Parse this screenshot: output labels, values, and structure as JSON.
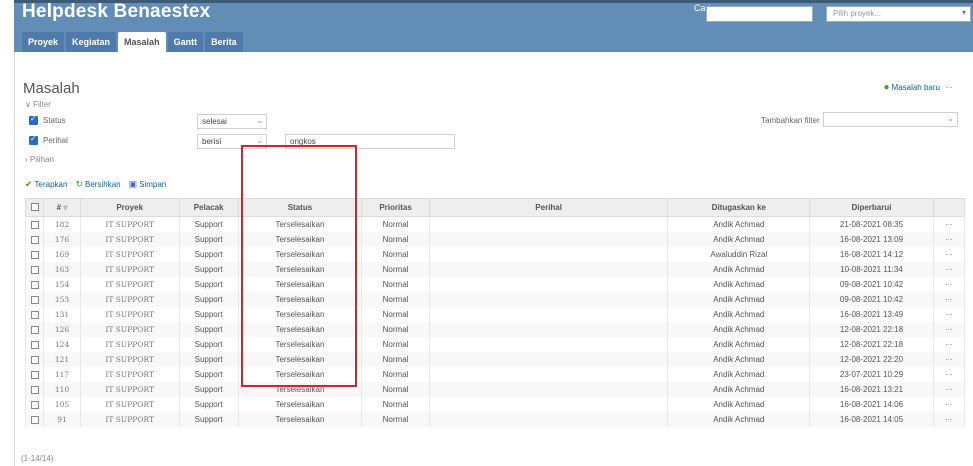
{
  "header": {
    "title": "Helpdesk Benaestex",
    "search_label": "Cari:",
    "project_placeholder": "Pilih proyek..."
  },
  "tabs": [
    "Proyek",
    "Kegiatan",
    "Masalah",
    "Gantt",
    "Berita"
  ],
  "active_tab": "Masalah",
  "page": {
    "title": "Masalah",
    "new_issue": "Masalah baru",
    "more": "···"
  },
  "filters": {
    "toggle": "Filter",
    "status": {
      "label": "Status",
      "operator": "selesai"
    },
    "subject": {
      "label": "Perihal",
      "operator": "berisi",
      "value": "ongkos"
    },
    "add_filter_label": "Tambahkan filter",
    "options_toggle": "Pilihan"
  },
  "actions": {
    "apply": "Terapkan",
    "clear": "Bersihkan",
    "save": "Simpan"
  },
  "table": {
    "headers": {
      "id": "#",
      "project": "Proyek",
      "tracker": "Pelacak",
      "status": "Status",
      "priority": "Prioritas",
      "subject": "Perihal",
      "assignee": "Ditugaskan ke",
      "updated": "Diperbarui"
    },
    "rows": [
      {
        "id": "182",
        "project": "IT SUPPORT",
        "tracker": "Support",
        "status": "Terselesaikan",
        "priority": "Normal",
        "assignee": "Andik Achmad",
        "updated": "21-08-2021 08:35"
      },
      {
        "id": "176",
        "project": "IT SUPPORT",
        "tracker": "Support",
        "status": "Terselesaikan",
        "priority": "Normal",
        "assignee": "Andik Achmad",
        "updated": "16-08-2021 13:09"
      },
      {
        "id": "169",
        "project": "IT SUPPORT",
        "tracker": "Support",
        "status": "Terselesaikan",
        "priority": "Normal",
        "assignee": "Awaluddin Rizal",
        "updated": "16-08-2021 14:12"
      },
      {
        "id": "163",
        "project": "IT SUPPORT",
        "tracker": "Support",
        "status": "Terselesaikan",
        "priority": "Normal",
        "assignee": "Andik Achmad",
        "updated": "10-08-2021 11:34"
      },
      {
        "id": "154",
        "project": "IT SUPPORT",
        "tracker": "Support",
        "status": "Terselesaikan",
        "priority": "Normal",
        "assignee": "Andik Achmad",
        "updated": "09-08-2021 10:42"
      },
      {
        "id": "153",
        "project": "IT SUPPORT",
        "tracker": "Support",
        "status": "Terselesaikan",
        "priority": "Normal",
        "assignee": "Andik Achmad",
        "updated": "09-08-2021 10:42"
      },
      {
        "id": "131",
        "project": "IT SUPPORT",
        "tracker": "Support",
        "status": "Terselesaikan",
        "priority": "Normal",
        "assignee": "Andik Achmad",
        "updated": "16-08-2021 13:49"
      },
      {
        "id": "126",
        "project": "IT SUPPORT",
        "tracker": "Support",
        "status": "Terselesaikan",
        "priority": "Normal",
        "assignee": "Andik Achmad",
        "updated": "12-08-2021 22:18"
      },
      {
        "id": "124",
        "project": "IT SUPPORT",
        "tracker": "Support",
        "status": "Terselesaikan",
        "priority": "Normal",
        "assignee": "Andik Achmad",
        "updated": "12-08-2021 22:18"
      },
      {
        "id": "121",
        "project": "IT SUPPORT",
        "tracker": "Support",
        "status": "Terselesaikan",
        "priority": "Normal",
        "assignee": "Andik Achmad",
        "updated": "12-08-2021 22:20"
      },
      {
        "id": "117",
        "project": "IT SUPPORT",
        "tracker": "Support",
        "status": "Terselesaikan",
        "priority": "Normal",
        "assignee": "Andik Achmad",
        "updated": "23-07-2021 10:29"
      },
      {
        "id": "110",
        "project": "IT SUPPORT",
        "tracker": "Support",
        "status": "Terselesaikan",
        "priority": "Normal",
        "assignee": "Andik Achmad",
        "updated": "16-08-2021 13:21"
      },
      {
        "id": "105",
        "project": "IT SUPPORT",
        "tracker": "Support",
        "status": "Terselesaikan",
        "priority": "Normal",
        "assignee": "Andik Achmad",
        "updated": "16-08-2021 14:06"
      },
      {
        "id": "91",
        "project": "IT SUPPORT",
        "tracker": "Support",
        "status": "Terselesaikan",
        "priority": "Normal",
        "assignee": "Andik Achmad",
        "updated": "16-08-2021 14:05"
      }
    ],
    "row_menu": "···"
  },
  "pagination": "(1-14/14)",
  "colors": {
    "header": "#628db6",
    "highlight": "#c42b2b",
    "link": "#116699"
  }
}
